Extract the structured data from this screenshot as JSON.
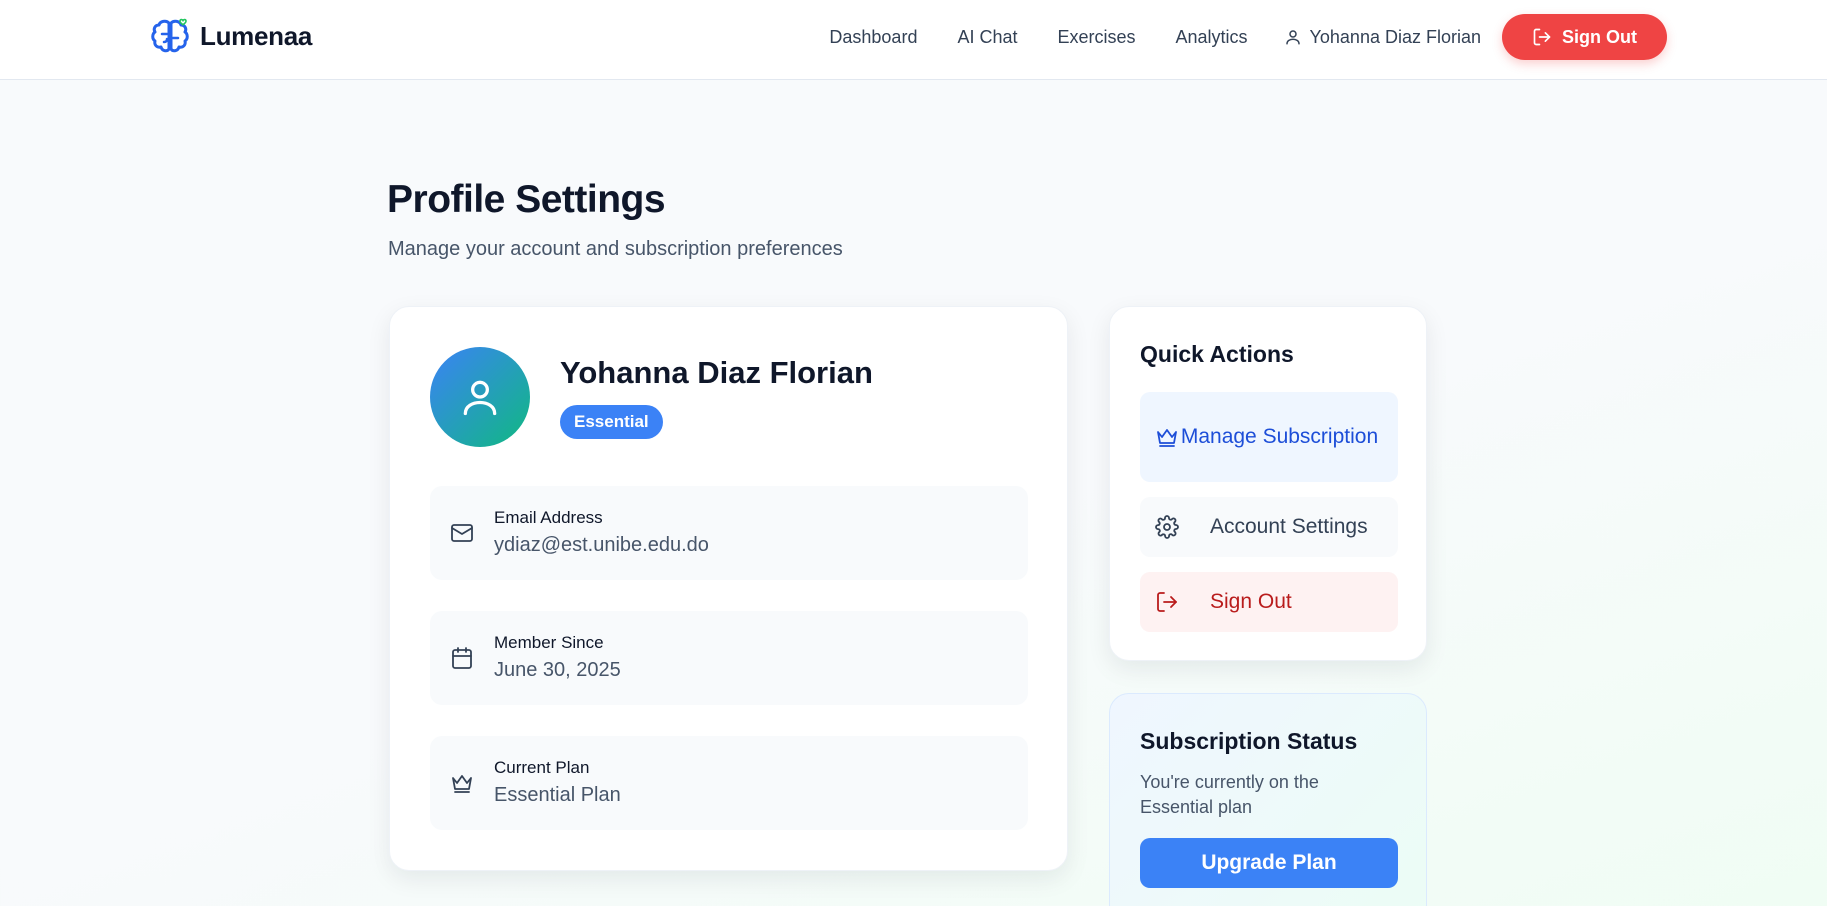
{
  "brand": {
    "name": "Lumenaa",
    "logo_icon": "brain-heart-icon"
  },
  "nav": {
    "links": [
      "Dashboard",
      "AI Chat",
      "Exercises",
      "Analytics"
    ],
    "user_name": "Yohanna Diaz Florian",
    "signout_label": "Sign Out"
  },
  "page": {
    "title": "Profile Settings",
    "subtitle": "Manage your account and subscription preferences"
  },
  "profile": {
    "name": "Yohanna Diaz Florian",
    "plan_badge": "Essential",
    "fields": [
      {
        "icon": "mail-icon",
        "label": "Email Address",
        "value": "ydiaz@est.unibe.edu.do"
      },
      {
        "icon": "calendar-icon",
        "label": "Member Since",
        "value": "June 30, 2025"
      },
      {
        "icon": "crown-icon",
        "label": "Current Plan",
        "value": "Essential Plan"
      }
    ]
  },
  "quick_actions": {
    "title": "Quick Actions",
    "manage_label": "Manage Subscription",
    "settings_label": "Account Settings",
    "signout_label": "Sign Out"
  },
  "subscription": {
    "title": "Subscription Status",
    "text": "You're currently on the Essential plan",
    "upgrade_label": "Upgrade Plan"
  },
  "colors": {
    "primary": "#3b82f6",
    "danger": "#ef4444",
    "accent_green": "#10b981"
  }
}
